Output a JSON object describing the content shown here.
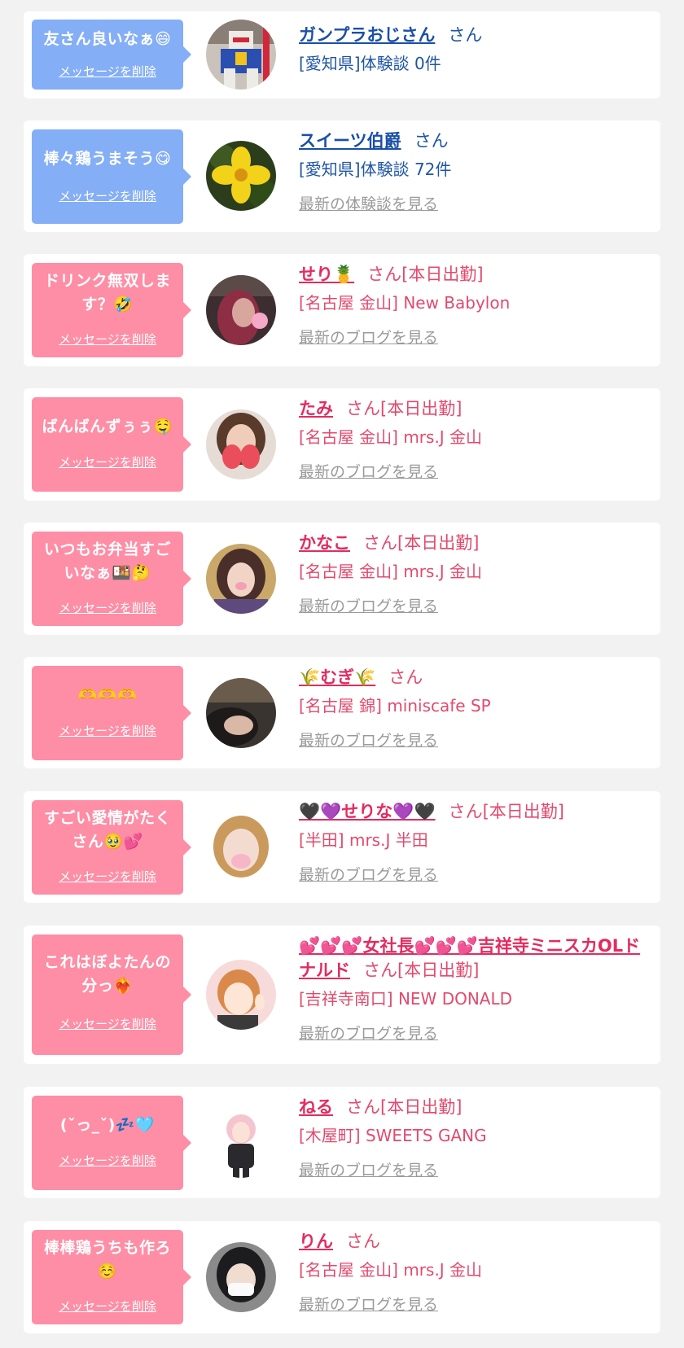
{
  "delete_label": "メッセージを削除",
  "items": [
    {
      "message": "友さん良いなぁ😄",
      "name": "ガンプラおじさん",
      "suffix": "さん",
      "shop": "[愛知県]体験談 0件",
      "link": "",
      "theme": "blue"
    },
    {
      "message": "棒々鶏うまそう😋",
      "name": "スイーツ伯爵",
      "suffix": "さん",
      "shop": "[愛知県]体験談 72件",
      "link": "最新の体験談を見る",
      "theme": "blue"
    },
    {
      "message": "ドリンク無双します？🤣",
      "name": "せり🍍",
      "suffix": "さん[本日出勤]",
      "shop": "[名古屋 金山] New Babylon",
      "link": "最新のブログを見る",
      "theme": "pink"
    },
    {
      "message": "ばんばんずぅぅ🤤",
      "name": "たみ",
      "suffix": "さん[本日出勤]",
      "shop": "[名古屋 金山] mrs.J 金山",
      "link": "最新のブログを見る",
      "theme": "pink"
    },
    {
      "message": "いつもお弁当すごいなぁ🍱🤔",
      "name": "かなこ",
      "suffix": "さん[本日出勤]",
      "shop": "[名古屋 金山] mrs.J 金山",
      "link": "最新のブログを見る",
      "theme": "pink"
    },
    {
      "message": "🫶🫶🫶",
      "name": "🌾むぎ🌾",
      "suffix": "さん",
      "shop": "[名古屋 錦] miniscafe SP",
      "link": "最新のブログを見る",
      "theme": "pink"
    },
    {
      "message": "すごい愛情がたくさん🥹💕",
      "name": "🖤💜せりな💜🖤",
      "suffix": "さん[本日出勤]",
      "shop": "[半田] mrs.J 半田",
      "link": "最新のブログを見る",
      "theme": "pink"
    },
    {
      "message": "これはぼよたんの分っ❤️‍🔥",
      "name": "💕💕💕女社長💕💕💕吉祥寺ミニスカOLドナルド",
      "suffix": "さん[本日出勤]",
      "shop": "[吉祥寺南口] NEW DONALD",
      "link": "最新のブログを見る",
      "theme": "pink"
    },
    {
      "message": "(ˇっ_ˇ)💤🩵",
      "name": "ねる",
      "suffix": "さん[本日出勤]",
      "shop": "[木屋町] SWEETS GANG",
      "link": "最新のブログを見る",
      "theme": "pink"
    },
    {
      "message": "棒棒鶏うちも作ろ☺️",
      "name": "りん",
      "suffix": "さん",
      "shop": "[名古屋 金山] mrs.J 金山",
      "link": "最新のブログを見る",
      "theme": "pink"
    }
  ]
}
